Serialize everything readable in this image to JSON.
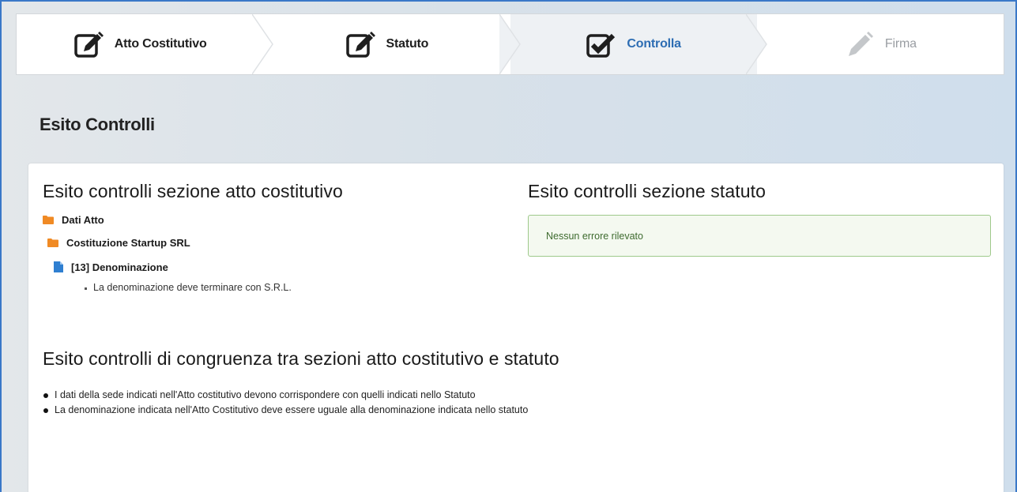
{
  "stepper": {
    "steps": [
      {
        "label": "Atto Costitutivo",
        "state": "complete",
        "icon": "edit-icon"
      },
      {
        "label": "Statuto",
        "state": "complete",
        "icon": "edit-icon"
      },
      {
        "label": "Controlla",
        "state": "active",
        "icon": "checkbox-icon"
      },
      {
        "label": "Firma",
        "state": "disabled",
        "icon": "pencil-icon"
      }
    ]
  },
  "page": {
    "title": "Esito Controlli"
  },
  "atto": {
    "heading": "Esito controlli sezione atto costitutivo",
    "tree": {
      "root": "Dati Atto",
      "child": "Costituzione Startup SRL",
      "field": "[13] Denominazione",
      "errors": [
        "La denominazione deve terminare con S.R.L."
      ]
    }
  },
  "statuto": {
    "heading": "Esito controlli sezione statuto",
    "message": "Nessun errore rilevato"
  },
  "congruenza": {
    "heading": "Esito controlli di congruenza tra sezioni atto costitutivo e statuto",
    "items": [
      "I dati della sede indicati nell'Atto costitutivo devono corrispondere con quelli indicati nello Statuto",
      "La denominazione indicata nell'Atto Costitutivo deve essere uguale alla denominazione indicata nello statuto"
    ]
  },
  "colors": {
    "accent": "#2d6db3",
    "folder": "#f08a24",
    "file": "#2f7fd1",
    "success_border": "#9ec98b",
    "success_text": "#3e6b2f"
  }
}
